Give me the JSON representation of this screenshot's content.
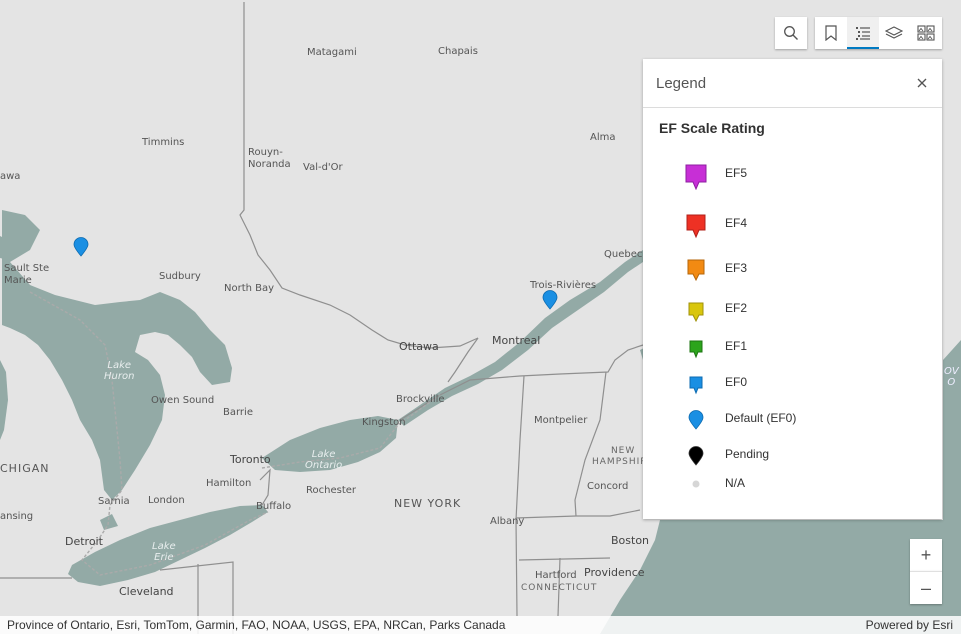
{
  "map": {
    "labels": {
      "matagami": "Matagami",
      "chapais": "Chapais",
      "timmins": "Timmins",
      "rouyn": "Rouyn-\nNoranda",
      "valdor": "Val-d'Or",
      "alma": "Alma",
      "awa": "awa",
      "sault": "Sault Ste\nMarie",
      "sudbury": "Sudbury",
      "northbay": "North Bay",
      "trois": "Trois-Rivières",
      "quebec": "Quebec",
      "ottawa": "Ottawa",
      "montreal": "Montreal",
      "lakehuron": "Lake\nHuron",
      "owensound": "Owen Sound",
      "barrie": "Barrie",
      "brockville": "Brockville",
      "kingston": "Kingston",
      "montpelier": "Montpelier",
      "newhampshire": "NEW\nHAMPSHIRE",
      "toronto": "Toronto",
      "lakeontario": "Lake\nOntario",
      "hamilton": "Hamilton",
      "rochester": "Rochester",
      "chigan": "CHIGAN",
      "concord": "Concord",
      "buffalo": "Buffalo",
      "newyork": "NEW YORK",
      "sarnia": "Sarnia",
      "london": "London",
      "ansing": "ansing",
      "albany": "Albany",
      "boston": "Boston",
      "detroit": "Detroit",
      "lakeerie": "Lake\nErie",
      "hartford": "Hartford",
      "providence": "Providence",
      "connecticut": "CONNECTICUT",
      "cleveland": "Cleveland",
      "ovo": "OV\nO"
    }
  },
  "toolbar": {
    "search_icon": "search-icon",
    "bookmarks_icon": "bookmark-icon",
    "legend_icon": "legend-list-icon",
    "layers_icon": "layers-icon",
    "basemap_icon": "basemap-gallery-icon"
  },
  "legend": {
    "title": "Legend",
    "close_icon": "close-icon",
    "layer_title": "EF Scale Rating",
    "items": [
      {
        "label": "EF5",
        "color": "#c72fd6"
      },
      {
        "label": "EF4",
        "color": "#ee3124"
      },
      {
        "label": "EF3",
        "color": "#f28a12"
      },
      {
        "label": "EF2",
        "color": "#d9c60d"
      },
      {
        "label": "EF1",
        "color": "#2ca41c"
      },
      {
        "label": "EF0",
        "color": "#1a8fe3"
      },
      {
        "label": "Default (EF0)",
        "color": "#1a8fe3"
      },
      {
        "label": "Pending",
        "color": "#000000"
      },
      {
        "label": "N/A",
        "color": "#d6d6d6"
      }
    ]
  },
  "zoom": {
    "in_label": "+",
    "out_label": "–"
  },
  "attribution": {
    "sources": "Province of Ontario, Esri, TomTom, Garmin, FAO, NOAA, USGS, EPA, NRCan, Parks Canada",
    "powered": "Powered by Esri"
  },
  "colors": {
    "land": "#e4e4e4",
    "water": "#93aaa6",
    "accent": "#007ac2"
  }
}
